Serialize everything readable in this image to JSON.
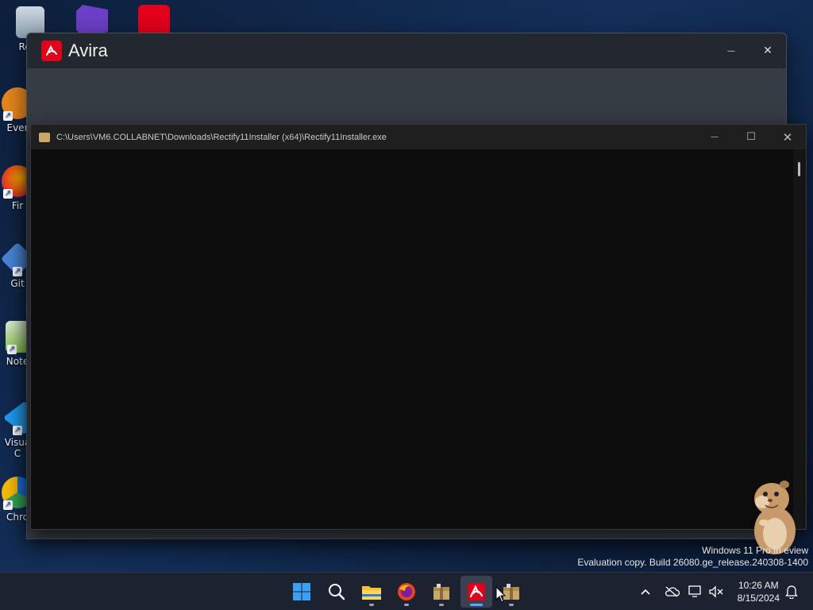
{
  "desktop": {
    "icons": [
      {
        "label": "Recy"
      },
      {
        "label": "Ever"
      },
      {
        "label": "Fir"
      },
      {
        "label": "Git"
      },
      {
        "label": "Note"
      },
      {
        "label": "Visua",
        "label2": "C"
      },
      {
        "label": "Chro"
      }
    ]
  },
  "avira_window": {
    "title": "Avira",
    "minimize_glyph": "—",
    "close_glyph": "✕",
    "brand_color": "#e3001b"
  },
  "console_window": {
    "title": "C:\\Users\\VM6.COLLABNET\\Downloads\\Rectify11Installer (x64)\\Rectify11Installer.exe",
    "minimize_glyph": "—",
    "maximize_glyph": "☐",
    "close_glyph": "✕"
  },
  "watermark": {
    "line1": "Windows 11 Pro In    eview",
    "line2": "Evaluation copy. Build 26080.ge_release.240308-1400"
  },
  "taskbar": {
    "apps": [
      {
        "icon": "windows-start-icon"
      },
      {
        "icon": "search-icon"
      },
      {
        "icon": "file-explorer-icon"
      },
      {
        "icon": "firefox-icon"
      },
      {
        "icon": "installer-icon"
      },
      {
        "icon": "avira-icon",
        "active": true
      },
      {
        "icon": "installer-icon"
      }
    ],
    "clock": {
      "time": "10:26 AM",
      "date": "8/15/2024"
    }
  }
}
